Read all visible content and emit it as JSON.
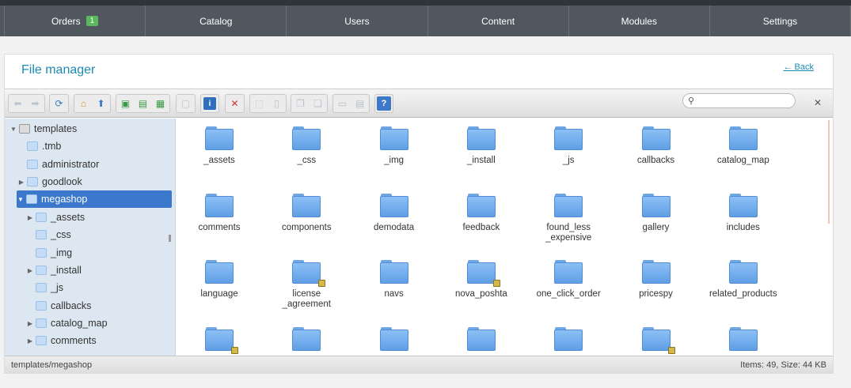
{
  "nav": {
    "items": [
      {
        "label": "Orders",
        "badge": "1"
      },
      {
        "label": "Catalog"
      },
      {
        "label": "Users"
      },
      {
        "label": "Content"
      },
      {
        "label": "Modules"
      },
      {
        "label": "Settings"
      }
    ]
  },
  "page": {
    "title": "File manager",
    "back_label": "← Back"
  },
  "toolbar": {
    "search_placeholder": "",
    "icons": [
      "back-icon",
      "forward-icon",
      "reload-icon",
      "home-icon",
      "up-icon",
      "new-folder-icon",
      "new-file-icon",
      "upload-icon",
      "save-icon",
      "info-icon",
      "delete-icon",
      "copy-icon",
      "paste-icon",
      "duplicate-icon",
      "extract-icon",
      "view-icon",
      "list-view-icon",
      "help-icon"
    ]
  },
  "tree": {
    "root": "templates",
    "items": [
      {
        "label": ".tmb"
      },
      {
        "label": "administrator"
      },
      {
        "label": "goodlook"
      },
      {
        "label": "megashop"
      },
      {
        "label": "_assets"
      },
      {
        "label": "_css"
      },
      {
        "label": "_img"
      },
      {
        "label": "_install"
      },
      {
        "label": "_js"
      },
      {
        "label": "callbacks"
      },
      {
        "label": "catalog_map"
      },
      {
        "label": "comments"
      }
    ]
  },
  "files": [
    {
      "name": "_assets"
    },
    {
      "name": "_css"
    },
    {
      "name": "_img"
    },
    {
      "name": "_install"
    },
    {
      "name": "_js"
    },
    {
      "name": "callbacks"
    },
    {
      "name": "catalog_map"
    },
    {
      "name": "comments"
    },
    {
      "name": "components"
    },
    {
      "name": "demodata"
    },
    {
      "name": "feedback"
    },
    {
      "name": "found_less\n_expensive"
    },
    {
      "name": "gallery"
    },
    {
      "name": "includes"
    },
    {
      "name": "language"
    },
    {
      "name": "license\n_agreement",
      "locked": true
    },
    {
      "name": "navs"
    },
    {
      "name": "nova_poshta",
      "locked": true
    },
    {
      "name": "one_click_order"
    },
    {
      "name": "pricespy"
    },
    {
      "name": "related_products"
    },
    {
      "name": "",
      "locked": true
    },
    {
      "name": ""
    },
    {
      "name": ""
    },
    {
      "name": ""
    },
    {
      "name": ""
    },
    {
      "name": "",
      "locked": true
    },
    {
      "name": ""
    }
  ],
  "status": {
    "path": "templates/megashop",
    "info": "Items: 49, Size: 44 KB"
  }
}
